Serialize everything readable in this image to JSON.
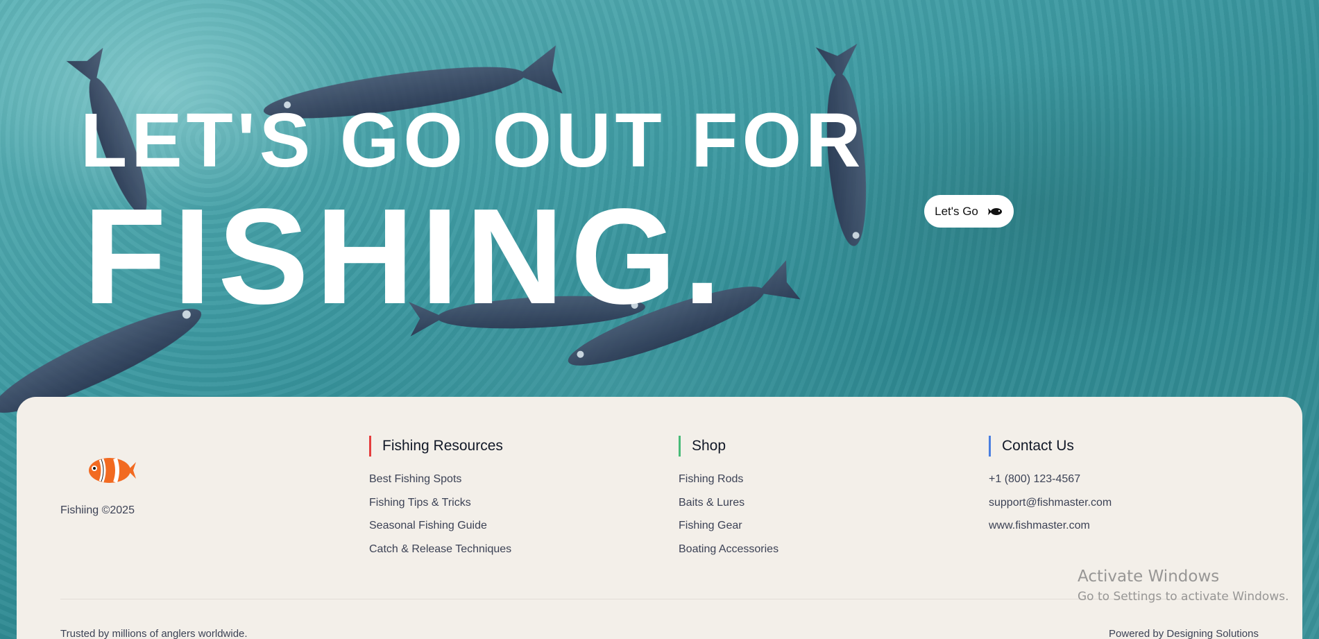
{
  "hero": {
    "line1": "LET'S GO OUT FOR",
    "line2": "FISHING.",
    "cta_label": "Let's Go",
    "cta_icon": "fish-icon"
  },
  "footer": {
    "brand": {
      "logo_icon": "clownfish-logo",
      "name": "Fishiing ©2025"
    },
    "columns": [
      {
        "title": "Fishing Resources",
        "accent": "#e53e3e",
        "items": [
          "Best Fishing Spots",
          "Fishing Tips & Tricks",
          "Seasonal Fishing Guide",
          "Catch & Release Techniques"
        ]
      },
      {
        "title": "Shop",
        "accent": "#48bb78",
        "items": [
          "Fishing Rods",
          "Baits & Lures",
          "Fishing Gear",
          "Boating Accessories"
        ]
      },
      {
        "title": "Contact Us",
        "accent": "#4a7fe0",
        "items": [
          "+1 (800) 123-4567",
          "support@fishmaster.com",
          "www.fishmaster.com"
        ]
      }
    ],
    "bottom_left": "Trusted by millions of anglers worldwide.",
    "bottom_right": "Powered by Designing Solutions"
  },
  "watermark": {
    "title": "Activate Windows",
    "subtitle": "Go to Settings to activate Windows."
  },
  "colors": {
    "water": "#3e9aa2",
    "footer_bg": "#f3efe9",
    "text_dark": "#3c4255",
    "clownfish": "#f26a21"
  }
}
